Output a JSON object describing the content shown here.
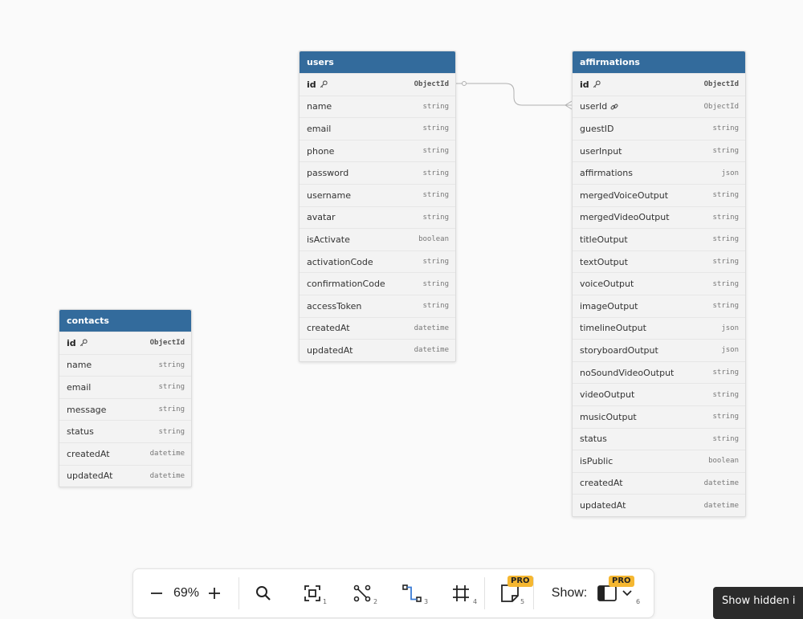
{
  "tables": {
    "users": {
      "title": "users",
      "fields": [
        {
          "name": "id",
          "type": "ObjectId",
          "key": true
        },
        {
          "name": "name",
          "type": "string"
        },
        {
          "name": "email",
          "type": "string"
        },
        {
          "name": "phone",
          "type": "string"
        },
        {
          "name": "password",
          "type": "string"
        },
        {
          "name": "username",
          "type": "string"
        },
        {
          "name": "avatar",
          "type": "string"
        },
        {
          "name": "isActivate",
          "type": "boolean"
        },
        {
          "name": "activationCode",
          "type": "string"
        },
        {
          "name": "confirmationCode",
          "type": "string"
        },
        {
          "name": "accessToken",
          "type": "string"
        },
        {
          "name": "createdAt",
          "type": "datetime"
        },
        {
          "name": "updatedAt",
          "type": "datetime"
        }
      ]
    },
    "affirmations": {
      "title": "affirmations",
      "fields": [
        {
          "name": "id",
          "type": "ObjectId",
          "key": true
        },
        {
          "name": "userId",
          "type": "ObjectId",
          "link": true
        },
        {
          "name": "guestID",
          "type": "string"
        },
        {
          "name": "userInput",
          "type": "string"
        },
        {
          "name": "affirmations",
          "type": "json"
        },
        {
          "name": "mergedVoiceOutput",
          "type": "string"
        },
        {
          "name": "mergedVideoOutput",
          "type": "string"
        },
        {
          "name": "titleOutput",
          "type": "string"
        },
        {
          "name": "textOutput",
          "type": "string"
        },
        {
          "name": "voiceOutput",
          "type": "string"
        },
        {
          "name": "imageOutput",
          "type": "string"
        },
        {
          "name": "timelineOutput",
          "type": "json"
        },
        {
          "name": "storyboardOutput",
          "type": "json"
        },
        {
          "name": "noSoundVideoOutput",
          "type": "string"
        },
        {
          "name": "videoOutput",
          "type": "string"
        },
        {
          "name": "musicOutput",
          "type": "string"
        },
        {
          "name": "status",
          "type": "string"
        },
        {
          "name": "isPublic",
          "type": "boolean"
        },
        {
          "name": "createdAt",
          "type": "datetime"
        },
        {
          "name": "updatedAt",
          "type": "datetime"
        }
      ]
    },
    "contacts": {
      "title": "contacts",
      "fields": [
        {
          "name": "id",
          "type": "ObjectId",
          "key": true
        },
        {
          "name": "name",
          "type": "string"
        },
        {
          "name": "email",
          "type": "string"
        },
        {
          "name": "message",
          "type": "string"
        },
        {
          "name": "status",
          "type": "string"
        },
        {
          "name": "createdAt",
          "type": "datetime"
        },
        {
          "name": "updatedAt",
          "type": "datetime"
        }
      ]
    }
  },
  "relation": {
    "from": "users.id",
    "to": "affirmations.userId"
  },
  "toolbar": {
    "zoom_value": "69%",
    "show_label": "Show:",
    "pro_badge": "PRO",
    "hotkeys": [
      "1",
      "2",
      "3",
      "4",
      "5",
      "6"
    ]
  },
  "tooltip": {
    "text": "Show hidden i"
  },
  "colors": {
    "header": "#336b9c",
    "pro_badge": "#f5b731",
    "background": "#fafafa"
  }
}
